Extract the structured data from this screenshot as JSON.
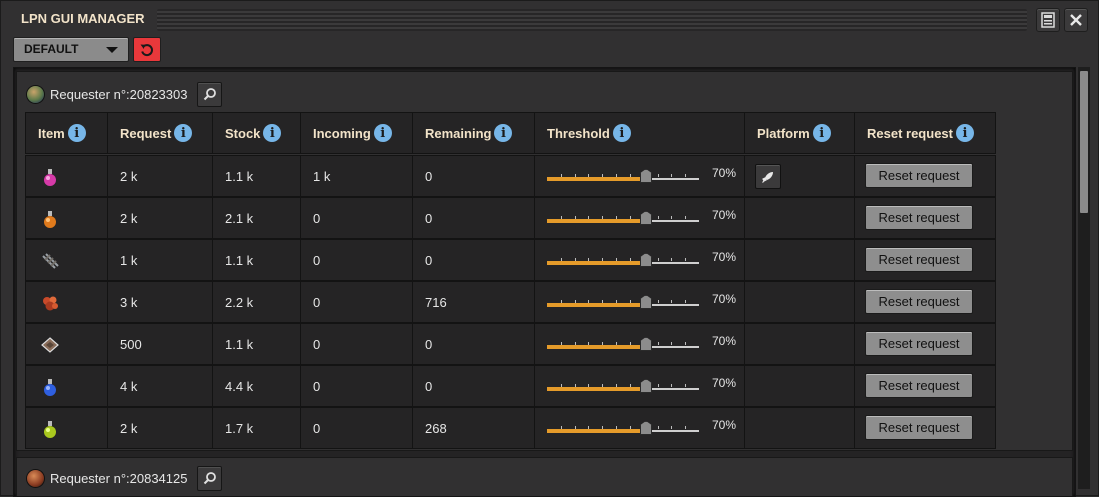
{
  "window": {
    "title": "LPN GUI MANAGER"
  },
  "titlebar": {
    "pin_icon": "pin-icon",
    "close_icon": "close-icon"
  },
  "toolbar": {
    "preset": "DEFAULT",
    "reset_icon": "undo-icon"
  },
  "colors": {
    "accent_orange": "#e59b2a",
    "info_blue": "#77b6e8",
    "reset_red": "#e9383b",
    "header_text": "#f2e3c9"
  },
  "requesters": [
    {
      "label": "Requester n°:20823303",
      "columns": [
        "Item",
        "Request",
        "Stock",
        "Incoming",
        "Remaining",
        "Threshold",
        "Platform",
        "Reset request"
      ],
      "rows": [
        {
          "item_icon": "military-science-pack-icon",
          "request": "2 k",
          "stock": "1.1 k",
          "incoming": "1 k",
          "remaining": "0",
          "threshold_pct": 70,
          "threshold_label": "70%",
          "platform": "rocket-icon",
          "reset": "Reset request"
        },
        {
          "item_icon": "production-science-pack-icon",
          "request": "2 k",
          "stock": "2.1 k",
          "incoming": "0",
          "remaining": "0",
          "threshold_pct": 70,
          "threshold_label": "70%",
          "platform": "",
          "reset": "Reset request"
        },
        {
          "item_icon": "rail-icon",
          "request": "1 k",
          "stock": "1.1 k",
          "incoming": "0",
          "remaining": "0",
          "threshold_pct": 70,
          "threshold_label": "70%",
          "platform": "",
          "reset": "Reset request"
        },
        {
          "item_icon": "copper-ore-icon",
          "request": "3 k",
          "stock": "2.2 k",
          "incoming": "0",
          "remaining": "716",
          "threshold_pct": 70,
          "threshold_label": "70%",
          "platform": "",
          "reset": "Reset request"
        },
        {
          "item_icon": "landfill-icon",
          "request": "500",
          "stock": "1.1 k",
          "incoming": "0",
          "remaining": "0",
          "threshold_pct": 70,
          "threshold_label": "70%",
          "platform": "",
          "reset": "Reset request"
        },
        {
          "item_icon": "chemical-science-pack-icon",
          "request": "4 k",
          "stock": "4.4 k",
          "incoming": "0",
          "remaining": "0",
          "threshold_pct": 70,
          "threshold_label": "70%",
          "platform": "",
          "reset": "Reset request"
        },
        {
          "item_icon": "utility-science-pack-icon",
          "request": "2 k",
          "stock": "1.7 k",
          "incoming": "0",
          "remaining": "268",
          "threshold_pct": 70,
          "threshold_label": "70%",
          "platform": "",
          "reset": "Reset request"
        }
      ]
    },
    {
      "label": "Requester n°:20834125"
    }
  ]
}
